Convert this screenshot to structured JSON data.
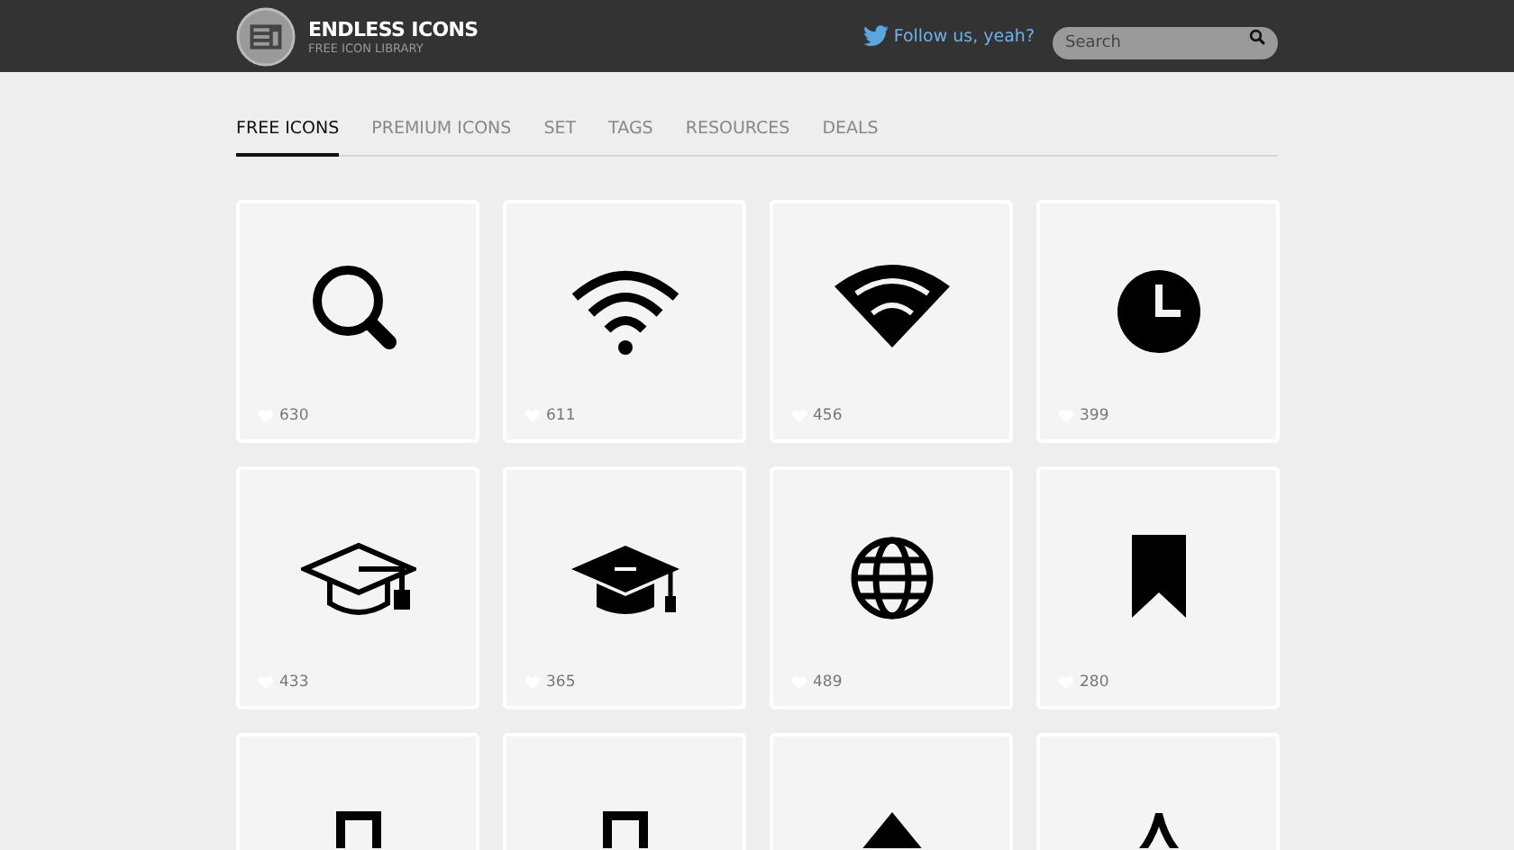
{
  "header": {
    "logo_title": "ENDLESS ICONS",
    "logo_subtitle": "FREE ICON LIBRARY",
    "follow_link": "Follow us, yeah?",
    "search": {
      "placeholder": "Search"
    }
  },
  "tabs": [
    {
      "label": "FREE ICONS",
      "selected": true
    },
    {
      "label": "PREMIUM ICONS",
      "selected": false
    },
    {
      "label": "SET",
      "selected": false
    },
    {
      "label": "TAGS",
      "selected": false
    },
    {
      "label": "RESOURCES",
      "selected": false
    },
    {
      "label": "DEALS",
      "selected": false
    }
  ],
  "icons": [
    {
      "kind": "search",
      "likes": "630"
    },
    {
      "kind": "wifi-arcs",
      "likes": "611"
    },
    {
      "kind": "wifi-fan",
      "likes": "456"
    },
    {
      "kind": "clock",
      "likes": "399"
    },
    {
      "kind": "cap-outline",
      "likes": "433"
    },
    {
      "kind": "cap",
      "likes": "365"
    },
    {
      "kind": "globe",
      "likes": "489"
    },
    {
      "kind": "bookmark",
      "likes": "280"
    },
    {
      "kind": "frame-outline"
    },
    {
      "kind": "frame-outline"
    },
    {
      "kind": "triangle"
    },
    {
      "kind": "arch-outline"
    }
  ]
}
